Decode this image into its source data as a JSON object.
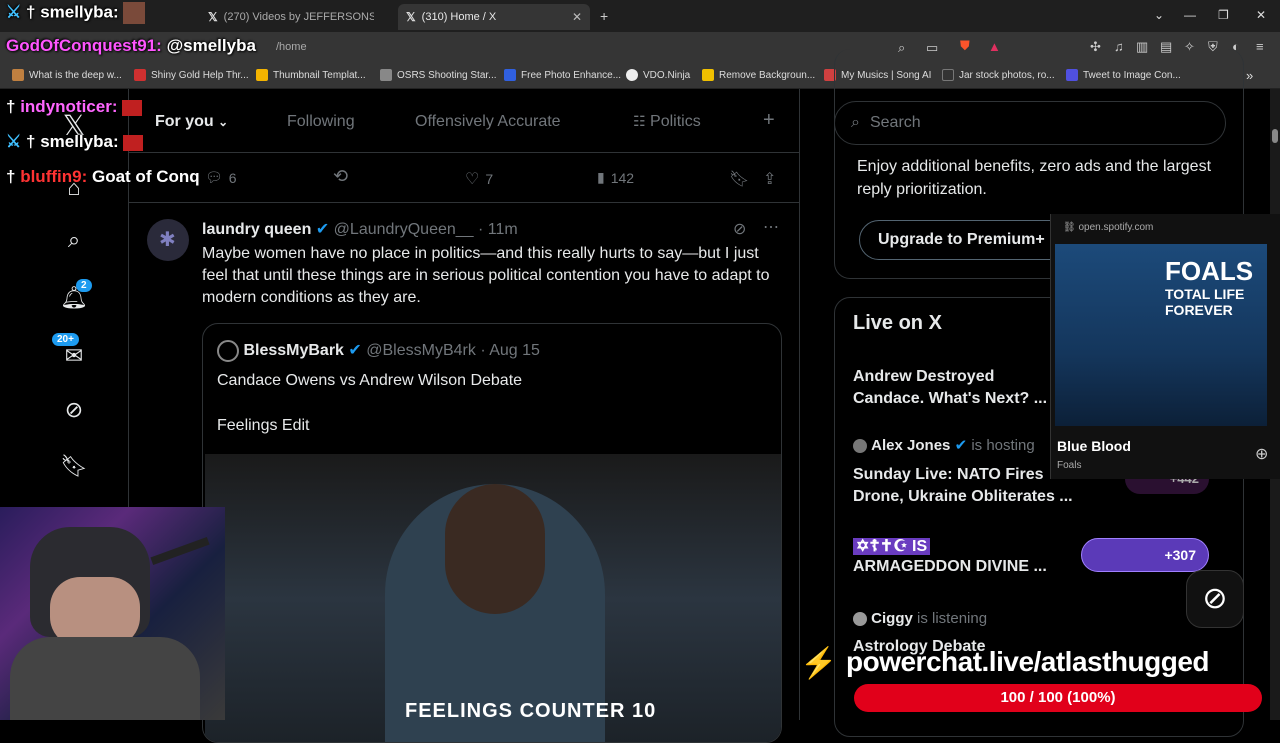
{
  "browser": {
    "tabs": [
      {
        "title": "smellyba",
        "active": false
      },
      {
        "title": "(270) Videos by JEFFERSONS VIOL",
        "active": false
      },
      {
        "title": "(310) Home / X",
        "active": true
      }
    ],
    "new_tab": "+",
    "url_display": "/home",
    "url_prefix": "@smellyba",
    "bookmarks": [
      {
        "label": "What is the deep w...",
        "color": "#c08040"
      },
      {
        "label": "Shiny Gold Help Thr...",
        "color": "#d03030"
      },
      {
        "label": "Thumbnail Templat...",
        "color": "#f4b400"
      },
      {
        "label": "OSRS Shooting Star...",
        "color": "#888888"
      },
      {
        "label": "Free Photo Enhance...",
        "color": "#3060e0"
      },
      {
        "label": "VDO.Ninja",
        "color": "#222222"
      },
      {
        "label": "Remove Backgroun...",
        "color": "#f0c000"
      },
      {
        "label": "My Musics | Song AI",
        "color": "#d04040"
      },
      {
        "label": "Jar stock photos, ro...",
        "color": "#333333"
      },
      {
        "label": "Tweet to Image Con...",
        "color": "#5050e0"
      }
    ],
    "bookmarks_more": "»"
  },
  "chat": [
    {
      "user": "smellyba:",
      "text": "",
      "user_color": "#ffffff"
    },
    {
      "user": "GodOfConquest91:",
      "text": "@smellyba",
      "user_color": "#ff55ff"
    },
    {
      "user": "indynoticer:",
      "text": "",
      "user_color": "#ff66ff"
    },
    {
      "user": "smellyba:",
      "text": "",
      "user_color": "#ffffff"
    },
    {
      "user": "bluffin9:",
      "text": "Goat of Conq",
      "user_color": "#ff3333"
    }
  ],
  "feed": {
    "tabs": [
      "For you",
      "Following",
      "Offensively Accurate",
      "Politics"
    ],
    "add_tab": "+",
    "prev_actions": {
      "replies": "6",
      "likes": "7",
      "views": "142"
    },
    "tweet": {
      "name": "laundry queen",
      "handle": "@LaundryQueen__",
      "time": "· 11m",
      "text": "Maybe women have no place in politics—and this really hurts to say—but I just feel that until these things are in serious political contention you have to adapt to modern conditions as they are.",
      "quote": {
        "name": "BlessMyBark",
        "handle": "@BlessMyB4rk",
        "time": "· Aug 15",
        "line1": "Candace Owens vs Andrew Wilson Debate",
        "line2": "Feelings Edit",
        "video_caption": "FEELINGS COUNTER 10"
      }
    }
  },
  "leftnav": {
    "notif_badge": "2",
    "msg_badge": "20+"
  },
  "sidebar": {
    "search_placeholder": "Search",
    "premium_text": "Enjoy additional benefits, zero ads and the largest reply prioritization.",
    "premium_button": "Upgrade to Premium+",
    "live_title": "Live on X",
    "live_items": [
      {
        "host": "",
        "host_suffix": "",
        "title": "Andrew Destroyed Candace. What's Next? ...",
        "count": ""
      },
      {
        "host": "Alex Jones",
        "host_suffix": "is hosting",
        "title": "Sunday Live: NATO Fires Drone, Ukraine Obliterates ...",
        "count": "+442"
      },
      {
        "host": "✡☦✝☪ IS",
        "host_suffix": "",
        "title": "ARMAGEDDON DIVINE ...",
        "count": "+307"
      },
      {
        "host": "Ciggy",
        "host_suffix": "is listening",
        "title": "Astrology Debate",
        "count": ""
      }
    ]
  },
  "spotify": {
    "domain": "open.spotify.com",
    "album_line1": "FOALS",
    "album_line2": "TOTAL LIFE",
    "album_line3": "FOREVER",
    "track": "Blue Blood",
    "artist": "Foals"
  },
  "powerchat": {
    "url": "powerchat.live/atlasthugged",
    "progress_text": "100 / 100 (100%)",
    "progress_fraction": 1.0
  }
}
